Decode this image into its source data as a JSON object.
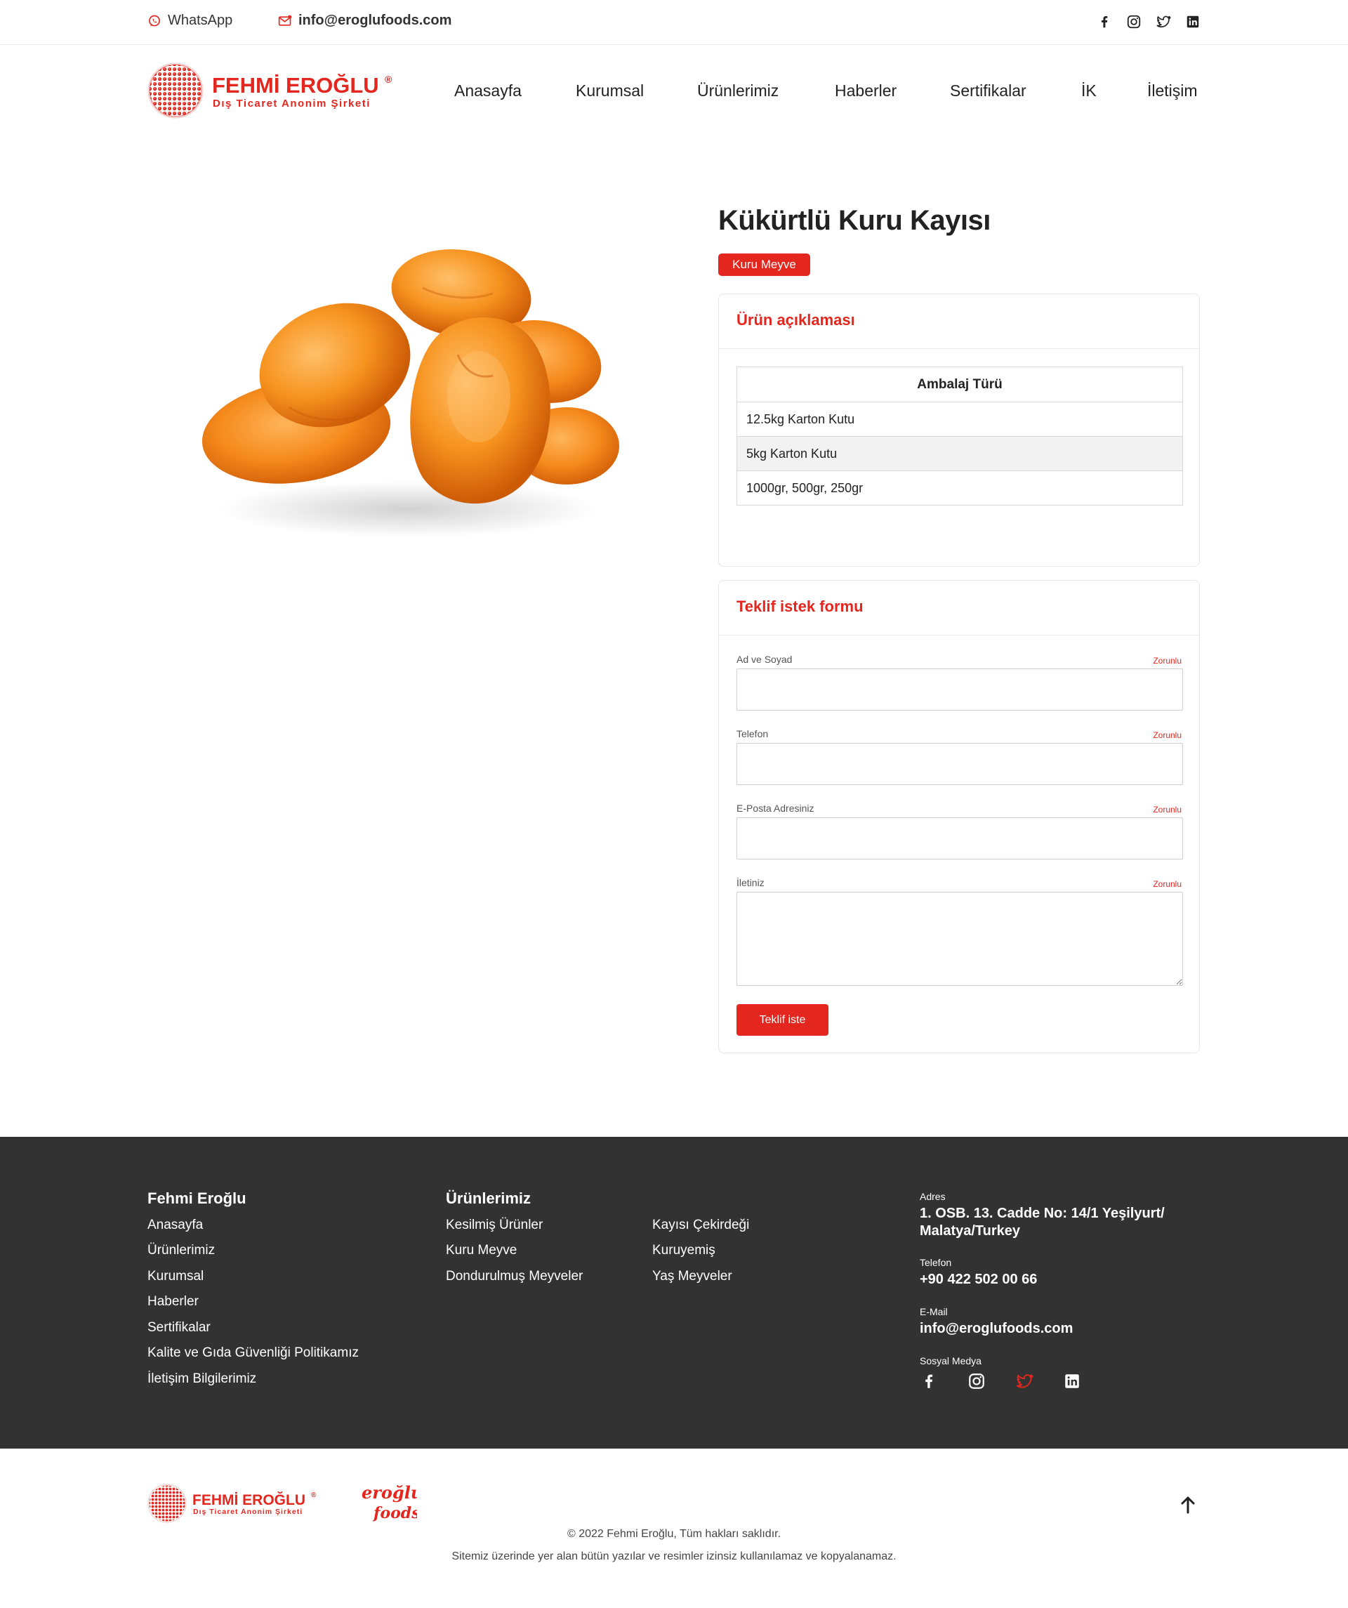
{
  "topbar": {
    "whatsapp_label": "WhatsApp",
    "email_label": "info@eroglufoods.com",
    "social_icons": [
      "facebook-icon",
      "instagram-icon",
      "twitter-icon",
      "linkedin-icon"
    ]
  },
  "brand": {
    "name": "FEHMİ EROĞLU",
    "subtitle": "Dış Ticaret Anonim Şirketi",
    "accent_color": "#e3261e"
  },
  "nav": {
    "items": [
      "Anasayfa",
      "Kurumsal",
      "Ürünlerimiz",
      "Haberler",
      "Sertifikalar",
      "İK",
      "İletişim"
    ]
  },
  "product": {
    "title": "Kükürtlü Kuru Kayısı",
    "category": "Kuru Meyve",
    "description_heading": "Ürün açıklaması",
    "table_header": "Ambalaj Türü",
    "table_rows": [
      "12.5kg Karton Kutu",
      "5kg Karton Kutu",
      "1000gr, 500gr, 250gr"
    ]
  },
  "form": {
    "heading": "Teklif istek formu",
    "required_label": "Zorunlu",
    "fields": [
      {
        "label": "Ad ve Soyad",
        "value": ""
      },
      {
        "label": "Telefon",
        "value": ""
      },
      {
        "label": "E-Posta Adresiniz",
        "value": ""
      },
      {
        "label": "İletiniz",
        "value": ""
      }
    ],
    "submit_label": "Teklif iste"
  },
  "footer": {
    "col1_heading": "Fehmi Eroğlu",
    "col1_links": [
      "Anasayfa",
      "Ürünlerimiz",
      "Kurumsal",
      "Haberler",
      "Sertifikalar",
      "Kalite ve Gıda Güvenliği Politikamız",
      "İletişim Bilgilerimiz"
    ],
    "col2_heading": "Ürünlerimiz",
    "col2_links_a": [
      "Kesilmiş Ürünler",
      "Kuru Meyve",
      "Dondurulmuş Meyveler"
    ],
    "col2_links_b": [
      "Kayısı Çekirdeği",
      "Kuruyemiş",
      "Yaş Meyveler"
    ],
    "address_label": "Adres",
    "address_value": "1. OSB. 13. Cadde No: 14/1 Yeşilyurt/ Malatya/Turkey",
    "phone_label": "Telefon",
    "phone_value": "+90 422 502 00 66",
    "email_label": "E-Mail",
    "email_value": "info@eroglufoods.com",
    "social_label": "Sosyal Medya",
    "social_icons": [
      "facebook-icon",
      "instagram-icon",
      "twitter-icon",
      "linkedin-icon"
    ]
  },
  "bottom": {
    "foods_logo_text_1": "eroğlu",
    "foods_logo_text_2": "foods",
    "copyright": "© 2022 Fehmi Eroğlu, Tüm hakları saklıdır.",
    "notice": "Sitemiz üzerinde yer alan bütün yazılar ve resimler izinsiz kullanılamaz ve kopyalanamaz."
  }
}
